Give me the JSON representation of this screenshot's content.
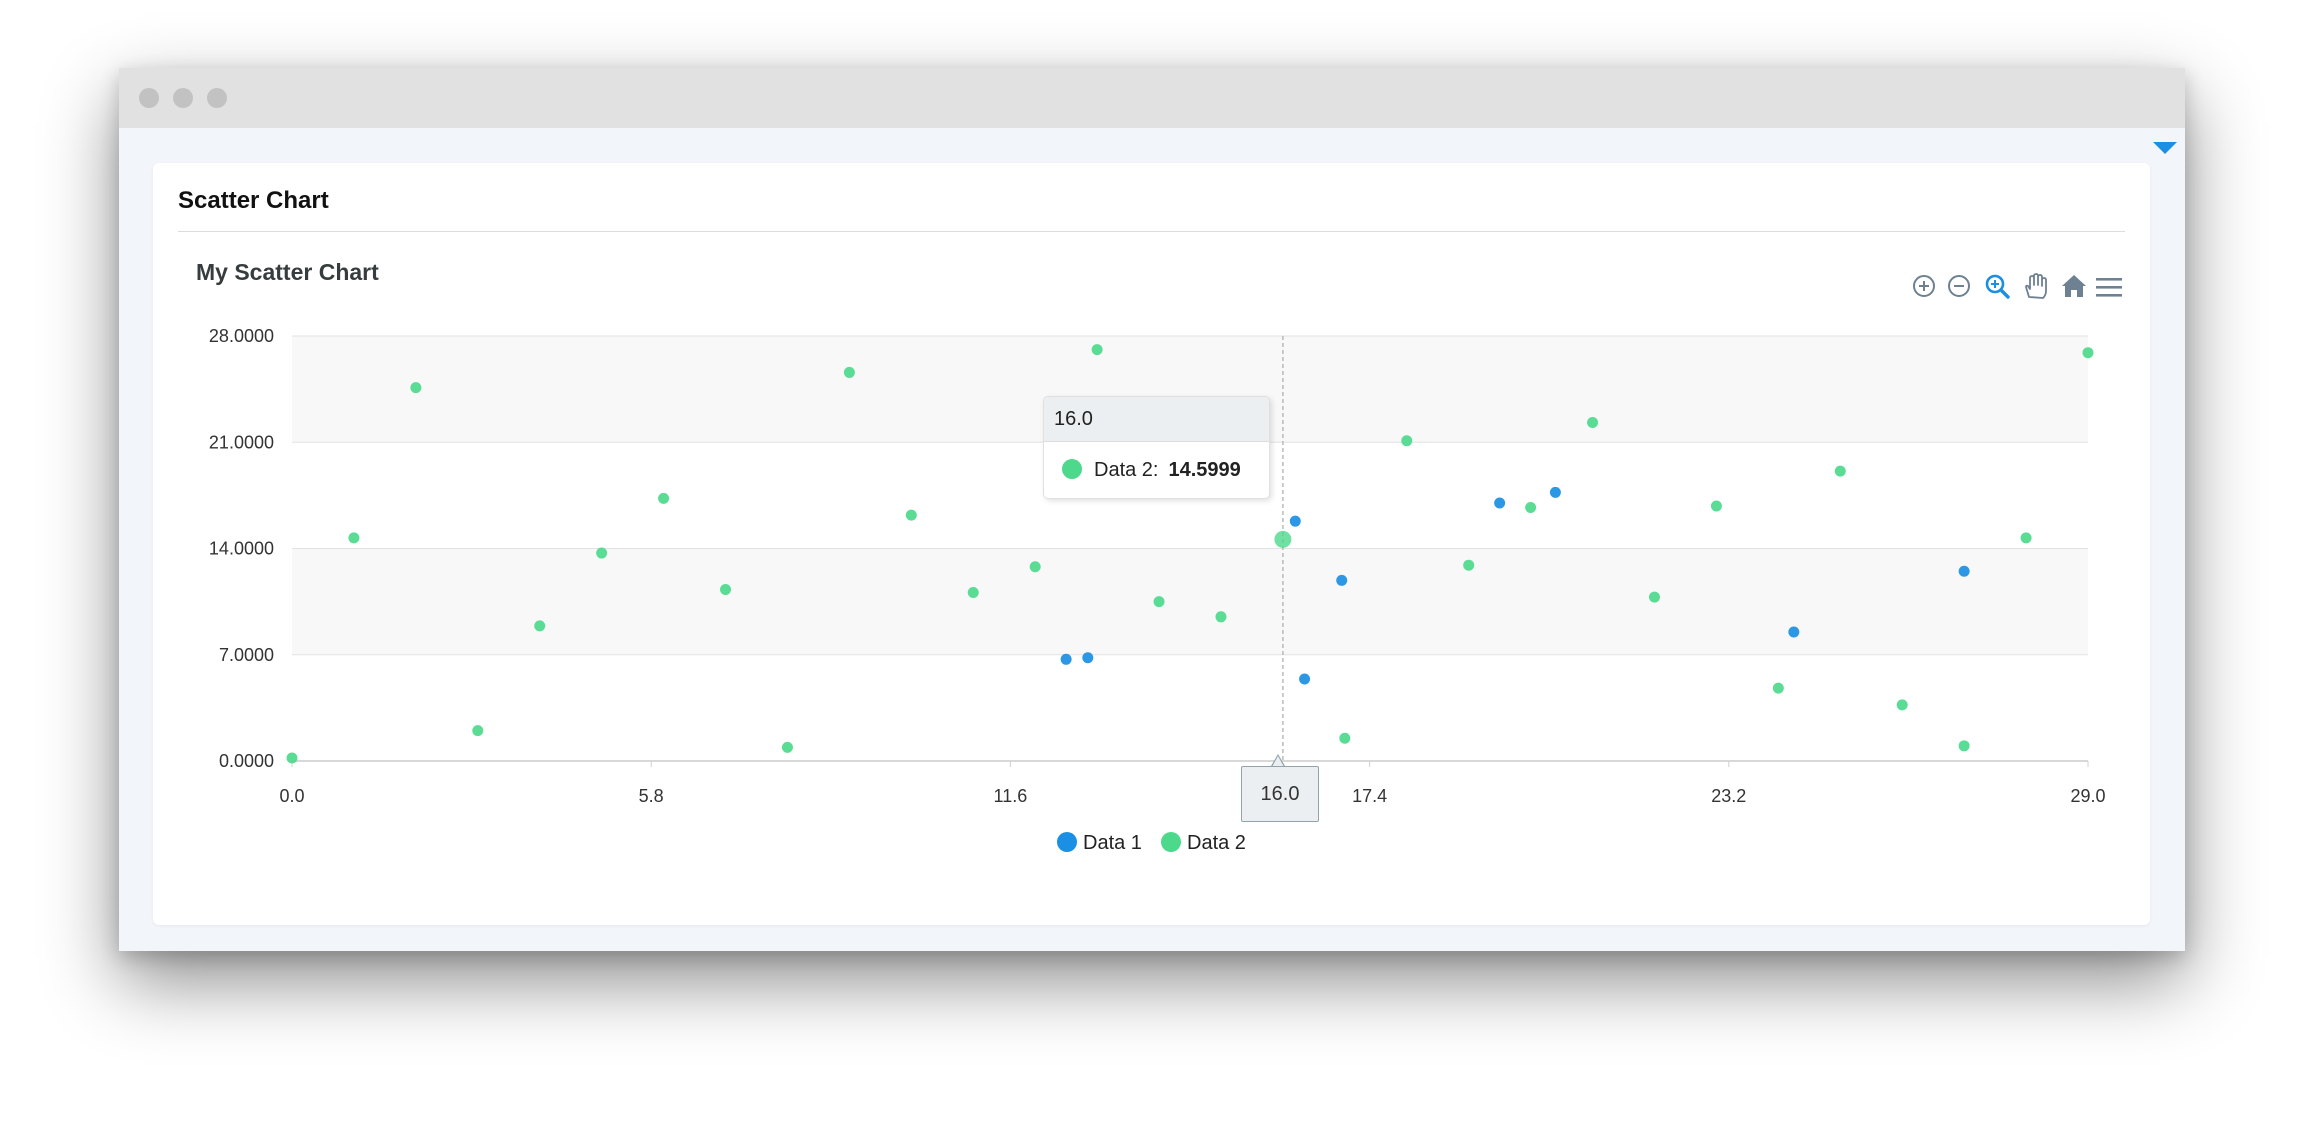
{
  "window": {
    "controls": [
      "close",
      "minimize",
      "maximize"
    ]
  },
  "card": {
    "title": "Scatter Chart"
  },
  "toolbar": {
    "icons": [
      "zoom-in-icon",
      "zoom-out-icon",
      "selection-zoom-icon",
      "pan-icon",
      "home-icon",
      "menu-icon"
    ]
  },
  "tooltip": {
    "x_value": "16.0",
    "series_label": "Data 2:",
    "value": "14.5999"
  },
  "xaxis_tooltip": "16.0",
  "colors": {
    "data1": "#1a8fe3",
    "data2": "#4cd98c",
    "accent": "#1a8fe3"
  },
  "chart_data": {
    "type": "scatter",
    "title": "My Scatter Chart",
    "xlabel": "",
    "ylabel": "",
    "xlim": [
      0,
      29
    ],
    "ylim": [
      0,
      28
    ],
    "x_ticks": [
      "0.0",
      "5.8",
      "11.6",
      "17.4",
      "23.2",
      "29.0"
    ],
    "y_ticks": [
      "28.0000",
      "21.0000",
      "14.0000",
      "7.0000",
      "0.0000"
    ],
    "grid": true,
    "legend": "bottom-center",
    "highlighted_point": {
      "series": "Data 2",
      "x": 16.0,
      "y": 14.5999
    },
    "series": [
      {
        "name": "Data 1",
        "color": "#1a8fe3",
        "points": [
          [
            12.5,
            6.7
          ],
          [
            12.85,
            6.8
          ],
          [
            16.2,
            15.8
          ],
          [
            16.35,
            5.4
          ],
          [
            16.95,
            11.9
          ],
          [
            19.5,
            17.0
          ],
          [
            20.4,
            17.7
          ],
          [
            24.25,
            8.5
          ],
          [
            27.0,
            12.5
          ]
        ]
      },
      {
        "name": "Data 2",
        "color": "#4cd98c",
        "points": [
          [
            0.0,
            0.2
          ],
          [
            1.0,
            14.7
          ],
          [
            2.0,
            24.6
          ],
          [
            3.0,
            2.0
          ],
          [
            4.0,
            8.9
          ],
          [
            5.0,
            13.7
          ],
          [
            6.0,
            17.3
          ],
          [
            7.0,
            11.3
          ],
          [
            8.0,
            0.9
          ],
          [
            9.0,
            25.6
          ],
          [
            10.0,
            16.2
          ],
          [
            11.0,
            11.1
          ],
          [
            12.0,
            12.8
          ],
          [
            13.0,
            27.1
          ],
          [
            14.0,
            10.5
          ],
          [
            15.0,
            9.5
          ],
          [
            16.0,
            14.5999
          ],
          [
            17.0,
            1.5
          ],
          [
            18.0,
            21.1
          ],
          [
            19.0,
            12.9
          ],
          [
            20.0,
            16.7
          ],
          [
            21.0,
            22.3
          ],
          [
            22.0,
            10.8
          ],
          [
            23.0,
            16.8
          ],
          [
            24.0,
            4.8
          ],
          [
            25.0,
            19.1
          ],
          [
            26.0,
            3.7
          ],
          [
            27.0,
            1.0
          ],
          [
            28.0,
            14.7
          ],
          [
            29.0,
            26.9
          ]
        ]
      }
    ]
  }
}
